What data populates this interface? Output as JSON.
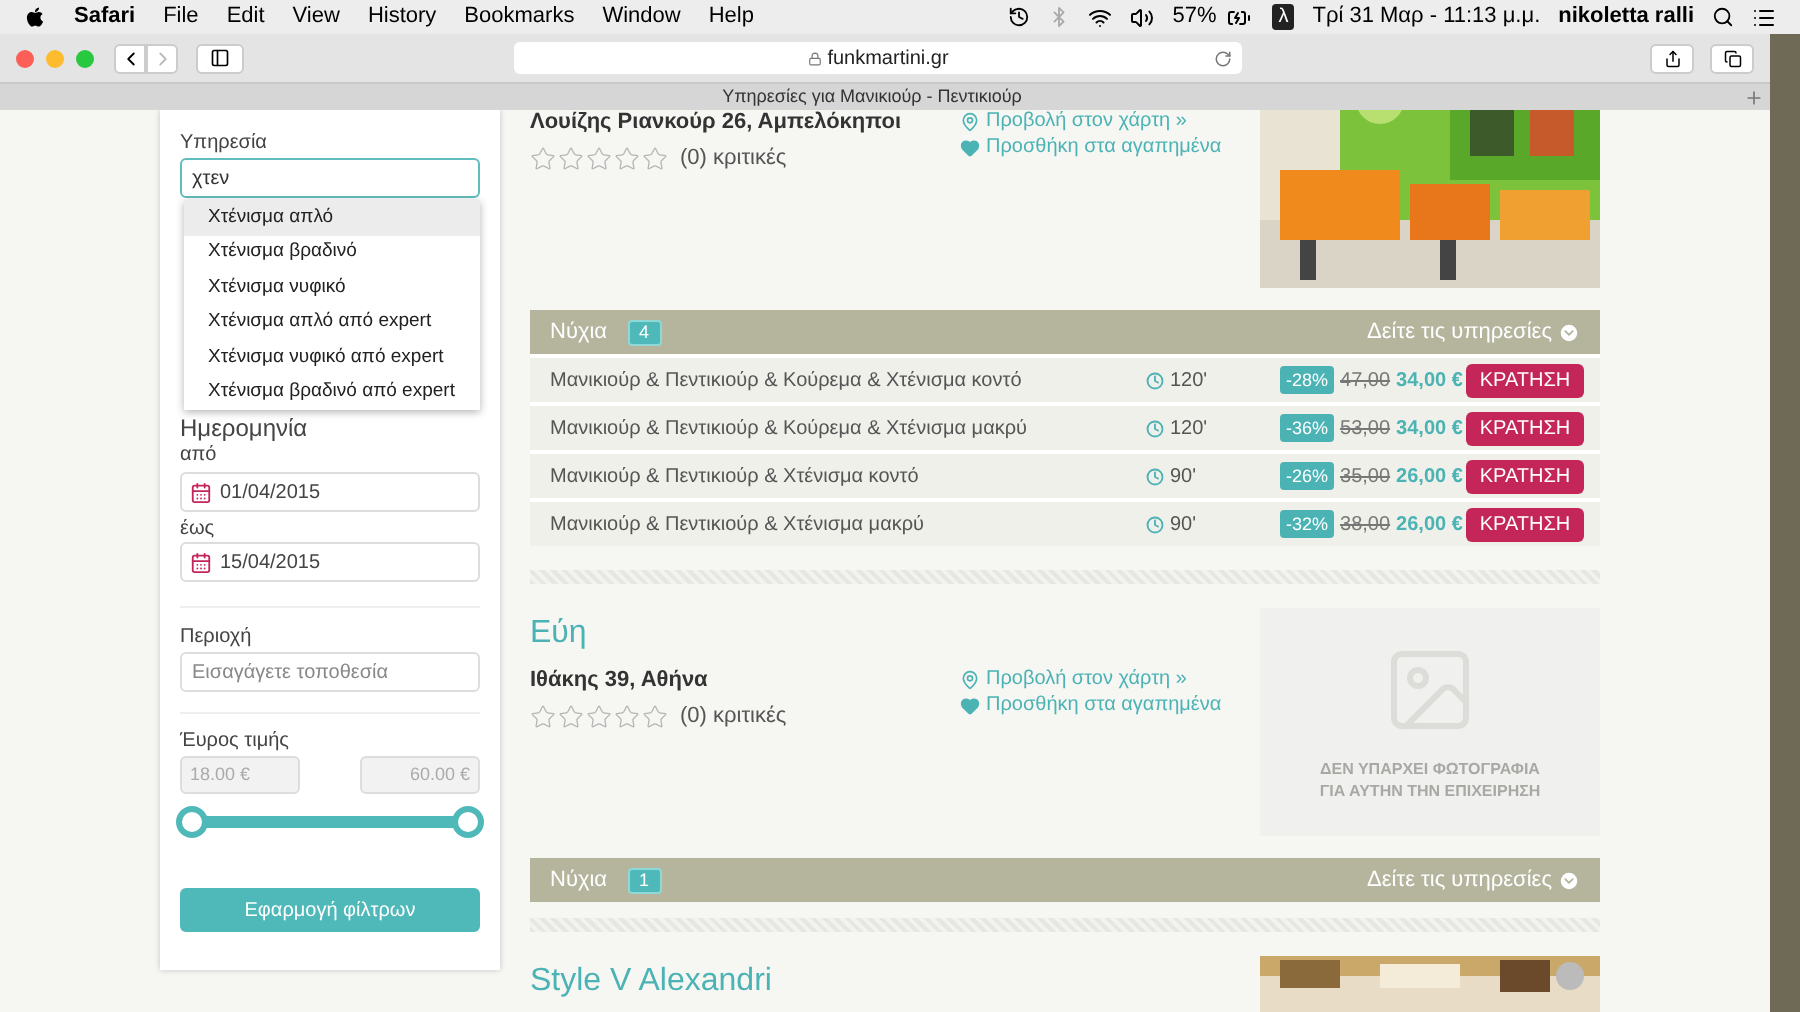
{
  "menu_bar": {
    "app": "Safari",
    "menus": [
      "File",
      "Edit",
      "View",
      "History",
      "Bookmarks",
      "Window",
      "Help"
    ],
    "battery": "57%",
    "lambda": "λ",
    "clock": "Τρί 31 Μαρ - 11:13 μ.μ.",
    "user": "nikoletta ralli"
  },
  "browser": {
    "url": "funkmartini.gr",
    "tab_title": "Υπηρεσίες για Μανικιούρ - Πεντικιούρ"
  },
  "filters": {
    "service": {
      "label": "Υπηρεσία",
      "value": "χτεν",
      "suggestions": [
        {
          "label": "Χτένισμα απλό",
          "selected": true
        },
        {
          "label": "Χτένισμα βραδινό",
          "selected": false
        },
        {
          "label": "Χτένισμα νυφικό",
          "selected": false
        },
        {
          "label": "Χτένισμα απλό από expert",
          "selected": false
        },
        {
          "label": "Χτένισμα νυφικό από expert",
          "selected": false
        },
        {
          "label": "Χτένισμα βραδινό από expert",
          "selected": false
        }
      ]
    },
    "date": {
      "heading": "Ημερομηνία",
      "from_label": "από",
      "from": "01/04/2015",
      "to_label": "έως",
      "to": "15/04/2015"
    },
    "area": {
      "label": "Περιοχή",
      "placeholder": "Εισαγάγετε τοποθεσία"
    },
    "price": {
      "label": "Έυρος τιμής",
      "min": "18.00 €",
      "max": "60.00 €",
      "thumbs": [
        {
          "level": 0
        },
        {
          "level": 1
        }
      ]
    },
    "apply_button": "Εφαρμογή φίλτρων"
  },
  "listings": [
    {
      "address": "Λουίζης Ριανκούρ 26, Αμπελόκηποι",
      "stars": 0,
      "reviews": "(0) κριτικές",
      "map_link": "Προβολή στον χάρτη »",
      "favorite_link": "Προσθήκη στα αγαπημένα",
      "category": "Νύχια",
      "count": "4",
      "toggle": "Δείτε τις υπηρεσίες",
      "services": [
        {
          "name": "Μανικιούρ & Πεντικιούρ & Κούρεμα & Χτένισμα κοντό",
          "duration": "120'",
          "discount": "-28%",
          "old_price": "47,00",
          "price": "34,00 €",
          "button": "ΚΡΑΤΗΣΗ"
        },
        {
          "name": "Μανικιούρ & Πεντικιούρ & Κούρεμα & Χτένισμα μακρύ",
          "duration": "120'",
          "discount": "-36%",
          "old_price": "53,00",
          "price": "34,00 €",
          "button": "ΚΡΑΤΗΣΗ"
        },
        {
          "name": "Μανικιούρ & Πεντικιούρ & Χτένισμα κοντό",
          "duration": "90'",
          "discount": "-26%",
          "old_price": "35,00",
          "price": "26,00 €",
          "button": "ΚΡΑΤΗΣΗ"
        },
        {
          "name": "Μανικιούρ & Πεντικιούρ & Χτένισμα μακρύ",
          "duration": "90'",
          "discount": "-32%",
          "old_price": "38,00",
          "price": "26,00 €",
          "button": "ΚΡΑΤΗΣΗ"
        }
      ]
    },
    {
      "name": "Εύη",
      "address": "Ιθάκης 39, Αθήνα",
      "stars": 0,
      "reviews": "(0) κριτικές",
      "map_link": "Προβολή στον χάρτη »",
      "favorite_link": "Προσθήκη στα αγαπημένα",
      "photo": {
        "kind": "placeholder",
        "lines": [
          "ΔΕΝ ΥΠΑΡΧΕΙ ΦΩΤΟΓΡΑΦΙΑ",
          "ΓΙΑ ΑΥΤΗΝ ΤΗΝ ΕΠΙΧΕΙΡΗΣΗ"
        ]
      },
      "category": "Νύχια",
      "count": "1",
      "toggle": "Δείτε τις υπηρεσίες"
    },
    {
      "name": "Style V Alexandri"
    }
  ]
}
